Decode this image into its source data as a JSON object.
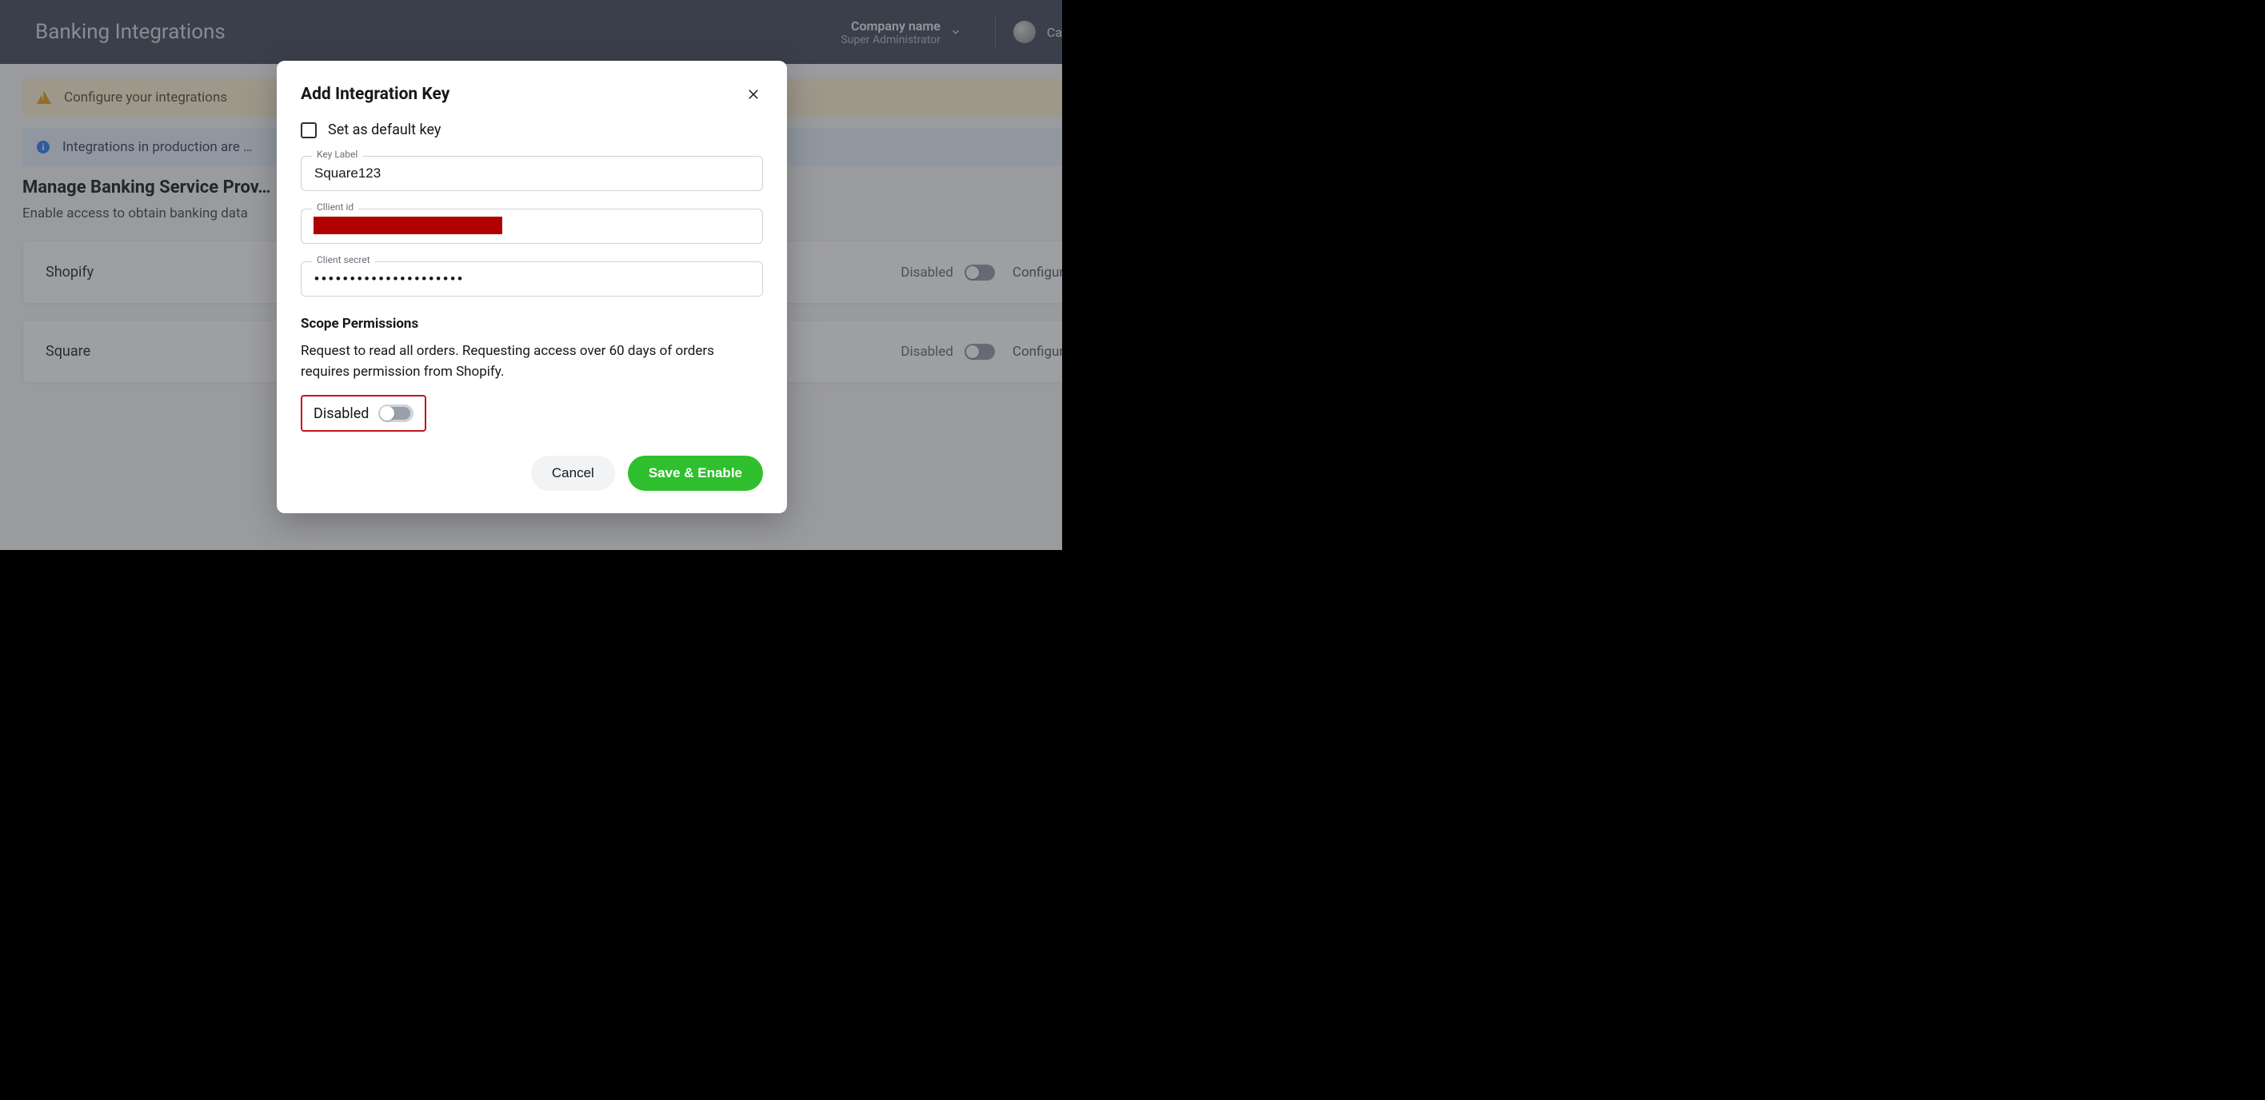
{
  "header": {
    "title": "Banking Integrations",
    "company_name": "Company name",
    "company_role": "Super Administrator",
    "user_name": "Calvin H."
  },
  "alerts": {
    "warn": "Configure your integrations",
    "info": "Integrations in production are …"
  },
  "section": {
    "title": "Manage Banking Service Prov…",
    "subtitle": "Enable access to obtain banking data"
  },
  "providers": [
    {
      "name": "Shopify",
      "state": "Disabled",
      "configure": "Configure"
    },
    {
      "name": "Square",
      "state": "Disabled",
      "configure": "Configure"
    }
  ],
  "modal": {
    "title": "Add Integration Key",
    "set_default_label": "Set as default key",
    "fields": {
      "key_label": {
        "label": "Key Label",
        "value": "Square123"
      },
      "client_id": {
        "label": "Cllient id",
        "value": ""
      },
      "client_secret": {
        "label": "Client secret",
        "value": "•••••••••••••••••••••"
      }
    },
    "scope": {
      "title": "Scope Permissions",
      "description": "Request to read all orders. Requesting access over 60 days of orders requires permission from Shopify.",
      "toggle_label": "Disabled"
    },
    "actions": {
      "cancel": "Cancel",
      "save": "Save & Enable"
    }
  }
}
